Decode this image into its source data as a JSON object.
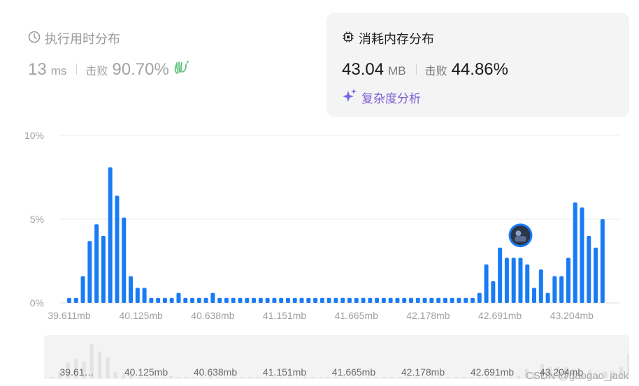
{
  "time": {
    "title": "执行用时分布",
    "value": "13",
    "unit": "ms",
    "beat_label": "击败",
    "beat_value": "90.70%",
    "icon": "clock-icon"
  },
  "memory": {
    "title": "消耗内存分布",
    "value": "43.04",
    "unit": "MB",
    "beat_label": "击败",
    "beat_value": "44.86%",
    "icon": "chip-icon",
    "complexity_label": "复杂度分析"
  },
  "watermark": "CSDN @gaogao_jack",
  "colors": {
    "bar": "#1a7cf5",
    "mini_bar": "#e3e3e3",
    "grid": "#ebebeb"
  },
  "chart_data": {
    "type": "bar",
    "title": "",
    "xlabel": "",
    "ylabel": "",
    "ylim": [
      0,
      10
    ],
    "y_ticks": [
      "0%",
      "5%",
      "10%"
    ],
    "x_tick_labels": [
      "39.611mb",
      "40.125mb",
      "40.638mb",
      "41.151mb",
      "41.665mb",
      "42.178mb",
      "42.691mb",
      "43.204mb"
    ],
    "mini_x_tick_labels": [
      "39.61…",
      "40.125mb",
      "40.638mb",
      "41.151mb",
      "41.665mb",
      "42.178mb",
      "42.691mb",
      "43.204mb"
    ],
    "values": [
      0.3,
      0.3,
      1.6,
      3.7,
      4.7,
      4.0,
      8.1,
      6.4,
      5.1,
      1.6,
      0.9,
      0.9,
      0.3,
      0.3,
      0.3,
      0.3,
      0.6,
      0.3,
      0.3,
      0.3,
      0.3,
      0.6,
      0.3,
      0.3,
      0.3,
      0.3,
      0.3,
      0.3,
      0.3,
      0.3,
      0.3,
      0.3,
      0.3,
      0.3,
      0.3,
      0.3,
      0.3,
      0.3,
      0.3,
      0.3,
      0.3,
      0.3,
      0.3,
      0.3,
      0.3,
      0.3,
      0.3,
      0.3,
      0.3,
      0.3,
      0.3,
      0.3,
      0.3,
      0.3,
      0.3,
      0.3,
      0.3,
      0.3,
      0.3,
      0.3,
      0.6,
      2.3,
      1.3,
      3.3,
      2.7,
      2.7,
      2.7,
      2.3,
      0.9,
      2.0,
      0.6,
      1.6,
      1.6,
      2.7,
      6.0,
      5.7,
      4.0,
      3.3,
      5.0
    ],
    "current_index": 66,
    "current_marker": "avatar"
  }
}
